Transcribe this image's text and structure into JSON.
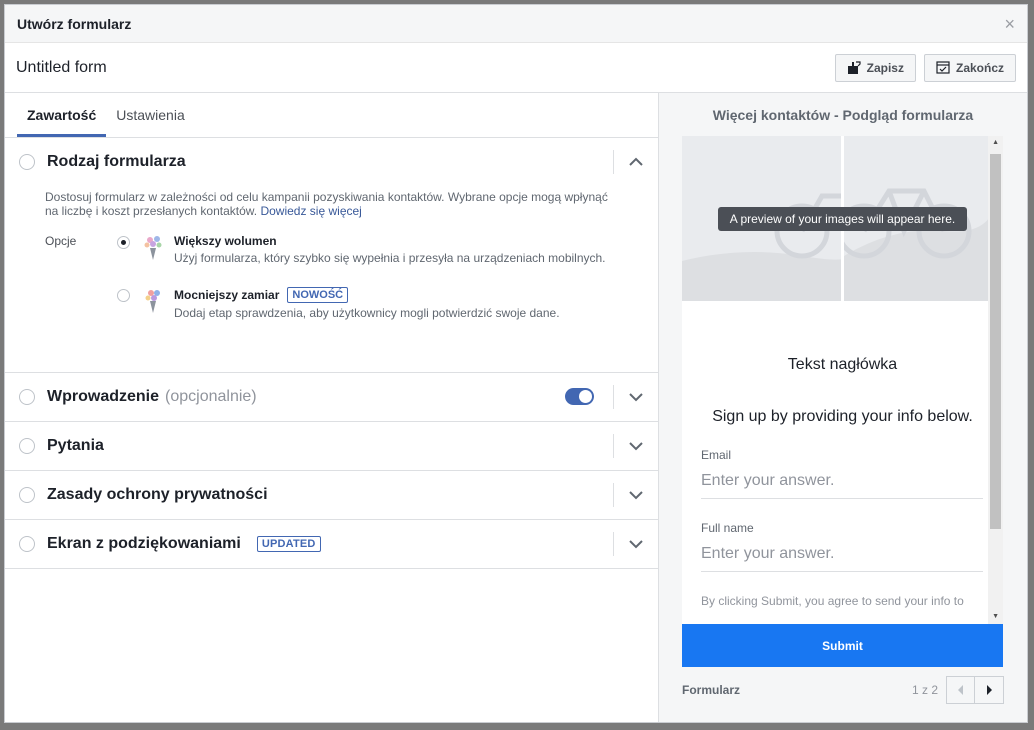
{
  "dialog": {
    "title": "Utwórz formularz",
    "close_glyph": "×"
  },
  "form_name": {
    "value": "Untitled form"
  },
  "toolbar": {
    "save_label": "Zapisz",
    "finish_label": "Zakończ"
  },
  "tabs": [
    {
      "label": "Zawartość",
      "active": true
    },
    {
      "label": "Ustawienia",
      "active": false
    }
  ],
  "form_type": {
    "title": "Rodzaj formularza",
    "description": "Dostosuj formularz w zależności od celu kampanii pozyskiwania kontaktów. Wybrane opcje mogą wpłynąć na liczbę i koszt przesłanych kontaktów.",
    "learn_more": "Dowiedz się więcej",
    "options_label": "Opcje",
    "options": [
      {
        "title": "Większy wolumen",
        "description": "Użyj formularza, który szybko się wypełnia i przesyła na urządzeniach mobilnych.",
        "selected": true
      },
      {
        "title": "Mocniejszy zamiar",
        "badge": "NOWOŚĆ",
        "description": "Dodaj etap sprawdzenia, aby użytkownicy mogli potwierdzić swoje dane.",
        "selected": false
      }
    ]
  },
  "sections": {
    "intro": {
      "title": "Wprowadzenie",
      "optional": "(opcjonalnie)",
      "enabled": true
    },
    "questions": {
      "title": "Pytania"
    },
    "privacy": {
      "title": "Zasady ochrony prywatności"
    },
    "thank_you": {
      "title": "Ekran z podziękowaniami",
      "badge": "UPDATED"
    }
  },
  "preview": {
    "title": "Więcej kontaktów - Podgląd formularza",
    "image_tip": "A preview of your images will appear here.",
    "headline": "Tekst nagłówka",
    "intro_text": "Sign up by providing your info below.",
    "fields": [
      {
        "label": "Email",
        "placeholder": "Enter your answer."
      },
      {
        "label": "Full name",
        "placeholder": "Enter your answer."
      }
    ],
    "consent": "By clicking Submit, you agree to send your info to",
    "submit_label": "Submit",
    "footer_label": "Formularz",
    "page_indicator": "1 z 2"
  },
  "colors": {
    "accent": "#4267b2",
    "submit": "#1877f2",
    "link": "#385898"
  }
}
